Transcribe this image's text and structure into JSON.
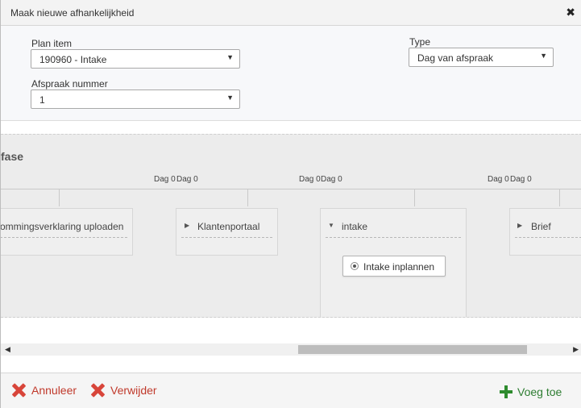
{
  "dialog": {
    "title": "Maak nieuwe afhankelijkheid",
    "close_glyph": "✖"
  },
  "form": {
    "plan_item": {
      "label": "Plan item",
      "value": "190960 - Intake"
    },
    "afspraak_nummer": {
      "label": "Afspraak nummer",
      "value": "1"
    },
    "type": {
      "label": "Type",
      "value": "Dag van afspraak"
    },
    "caret": "▼"
  },
  "flow": {
    "phase_title": "fase",
    "day_labels": [
      "Dag 0",
      "Dag 0",
      "Dag 0",
      "Dag 0",
      "Dag 0",
      "Dag 0"
    ],
    "nodes": [
      {
        "label": "ommingsverklaring uploaden",
        "expanded": false,
        "arrow": ""
      },
      {
        "label": "Klantenportaal",
        "expanded": false,
        "arrow": "▶"
      },
      {
        "label": "intake",
        "expanded": true,
        "arrow": "▼"
      },
      {
        "label": "Brief",
        "expanded": false,
        "arrow": "▶"
      }
    ],
    "intake_task": "Intake inplannen"
  },
  "scrollbar": {
    "left_arrow": "◀",
    "right_arrow": "▶"
  },
  "footer": {
    "cancel_label": "Annuleer",
    "delete_label": "Verwijder",
    "add_label": "Voeg toe"
  },
  "colors": {
    "danger": "#c0392b",
    "success": "#2e7d32",
    "canvas_bg": "#ececec"
  }
}
